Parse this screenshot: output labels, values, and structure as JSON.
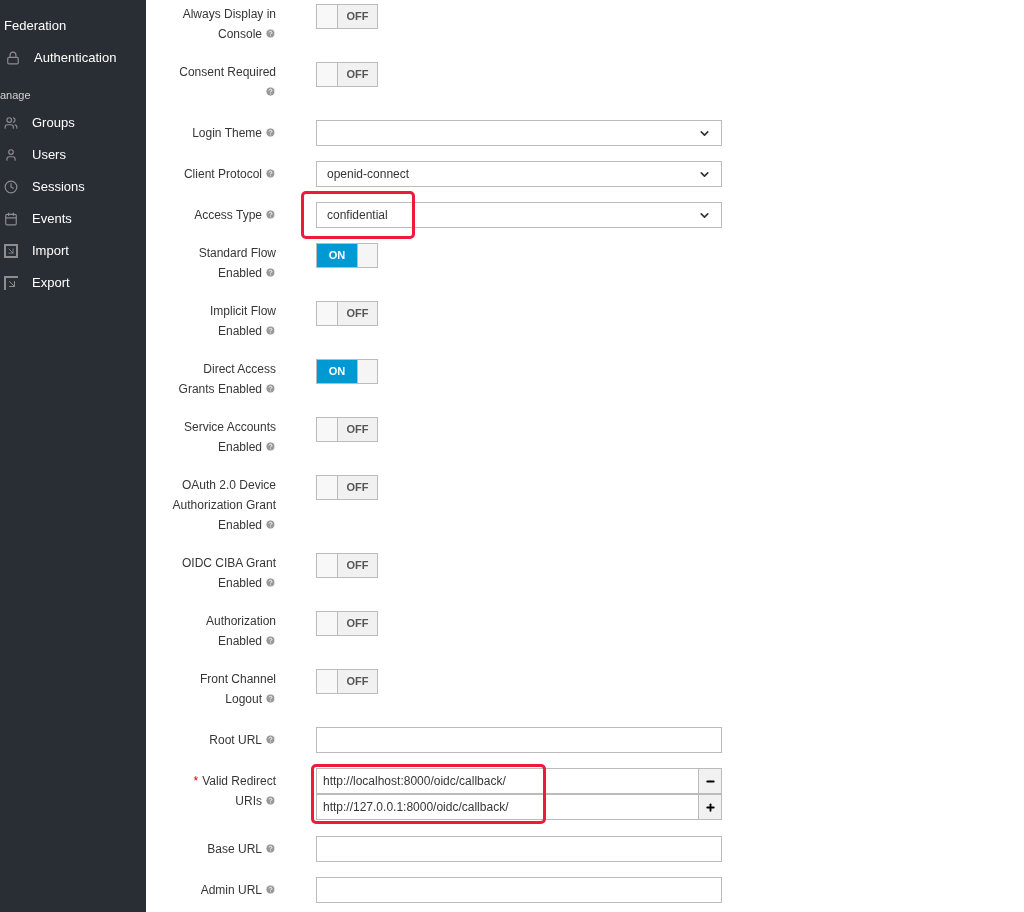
{
  "sidebar": {
    "items": [
      {
        "label": "Federation"
      },
      {
        "label": "Authentication"
      }
    ],
    "section": "anage",
    "manage_items": [
      {
        "label": "Groups"
      },
      {
        "label": "Users"
      },
      {
        "label": "Sessions"
      },
      {
        "label": "Events"
      },
      {
        "label": "Import"
      },
      {
        "label": "Export"
      }
    ]
  },
  "fields": [
    {
      "kind": "toggle",
      "label": "Always Display in Console",
      "on": false,
      "text": "OFF"
    },
    {
      "kind": "toggle",
      "label": "Consent Required",
      "on": false,
      "text": "OFF"
    },
    {
      "kind": "select",
      "label": "Login Theme"
    },
    {
      "kind": "select",
      "label": "Client Protocol",
      "value": "openid-connect"
    },
    {
      "kind": "select",
      "label": "Access Type",
      "value": "confidential",
      "highlighted": true
    },
    {
      "kind": "toggle",
      "label": "Standard Flow Enabled",
      "on": true,
      "text": "ON"
    },
    {
      "kind": "toggle",
      "label": "Implicit Flow Enabled",
      "on": false,
      "text": "OFF"
    },
    {
      "kind": "toggle",
      "label": "Direct Access Grants Enabled",
      "on": true,
      "text": "ON"
    },
    {
      "kind": "toggle",
      "label": "Service Accounts Enabled",
      "on": false,
      "text": "OFF"
    },
    {
      "kind": "toggle",
      "label": "OAuth 2.0 Device Authorization Grant Enabled",
      "on": false,
      "text": "OFF"
    },
    {
      "kind": "toggle",
      "label": "OIDC CIBA Grant Enabled",
      "on": false,
      "text": "OFF"
    },
    {
      "kind": "toggle",
      "label": "Authorization Enabled",
      "on": false,
      "text": "OFF"
    },
    {
      "kind": "toggle",
      "label": "Front Channel Logout",
      "on": false,
      "text": "OFF"
    },
    {
      "kind": "text",
      "label": "Root URL"
    },
    {
      "kind": "multi",
      "label": "Valid Redirect URIs",
      "required": true,
      "required_mark": "*",
      "highlighted": true,
      "values": [
        "http://localhost:8000/oidc/callback/",
        "http://127.0.0.1:8000/oidc/callback/"
      ]
    },
    {
      "kind": "text",
      "label": "Base URL"
    },
    {
      "kind": "text",
      "label": "Admin URL"
    }
  ]
}
